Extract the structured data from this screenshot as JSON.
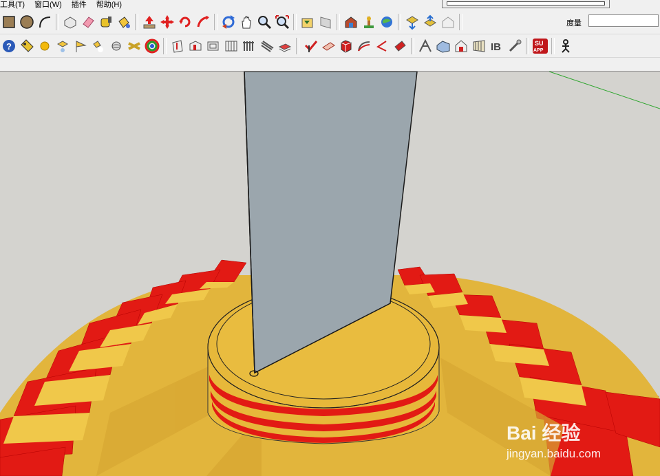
{
  "menu": {
    "items": [
      "工具(T)",
      "窗口(W)",
      "插件",
      "帮助(H)"
    ]
  },
  "measurement": {
    "label": "度量",
    "value": ""
  },
  "toolbar1": {
    "icons": [
      "rectangle-icon",
      "circle-icon",
      "arc-icon",
      "make-component-icon",
      "eraser-icon",
      "tape-measure-icon",
      "paint-bucket-icon",
      "push-pull-icon",
      "move-icon",
      "rotate-icon",
      "follow-me-icon",
      "orbit-icon",
      "pan-icon",
      "zoom-icon",
      "zoom-extents-icon",
      "previous-view-icon",
      "next-view-icon",
      "warehouse-icon",
      "share-model-icon",
      "google-earth-icon",
      "get-models-icon",
      "share-component-icon",
      "extension-warehouse-icon"
    ]
  },
  "toolbar2": {
    "icons": [
      "help-icon",
      "tag-icon",
      "sphere-icon",
      "shadow-icon",
      "flag-icon",
      "light-icon",
      "sphere-outline-icon",
      "cross-icon",
      "rainbow-icon",
      "shape-icon-1",
      "shape-icon-2",
      "shape-icon-3",
      "shape-icon-4",
      "shape-icon-5",
      "shape-icon-6",
      "stairs-icon",
      "cut-icon",
      "plane-icon",
      "box-icon",
      "curve-icon",
      "pen-icon",
      "paint-icon",
      "truss-icon",
      "building-icon",
      "roof-icon",
      "wall-icon",
      "text-b-icon",
      "key-icon",
      "su-app-icon",
      "person-icon"
    ]
  },
  "watermark": {
    "logo": "Bai 经验",
    "url": "jingyan.baidu.com"
  },
  "colors": {
    "pole": "#9ba6ad",
    "gold": "#e0b43a",
    "red": "#e01010",
    "background": "#d4d3cf"
  }
}
